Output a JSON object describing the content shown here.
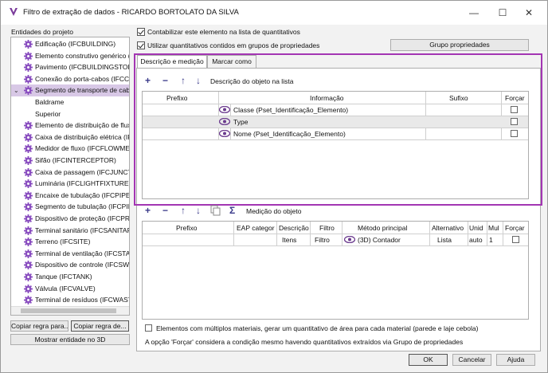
{
  "window": {
    "title": "Filtro de extração de dados - RICARDO BORTOLATO DA SILVA",
    "controls": {
      "close": "✕",
      "minimize": "—",
      "maximize": "☐"
    }
  },
  "left_panel": {
    "header": "Entidades do projeto",
    "items": [
      "Edificação (IFCBUILDING)",
      "Elemento construtivo genérico (I",
      "Pavimento (IFCBUILDINGSTOREY",
      "Conexão do porta-cabos (IFCCAI",
      "Segmento de transporte de cabo",
      "Baldrame",
      "Superior",
      "Elemento de distribuição de flux",
      "Caixa de distribuição elétrica (IFC",
      "Medidor de fluxo (IFCFLOWMETI",
      "Sifão (IFCINTERCEPTOR)",
      "Caixa de passagem (IFCJUNCTIO",
      "Luminária (IFCLIGHTFIXTURE)",
      "Encaixe de tubulação (IFCPIPEFIT",
      "Segmento de tubulação (IFCPIPE",
      "Dispositivo de proteção (IFCPRO",
      "Terminal sanitário (IFCSANITARY",
      "Terreno (IFCSITE)",
      "Terminal de ventilação (IFCSTACI",
      "Dispositivo de controle (IFCSWIT",
      "Tanque (IFCTANK)",
      "Válvula (IFCVALVE)",
      "Terminal de resíduos (IFCWASTE"
    ],
    "copy_rule_button_1": "Copiar regra para...",
    "copy_rule_button_2": "Copiar regra de...",
    "show_3d_button": "Mostrar entidade no 3D"
  },
  "options": {
    "count_element_label": "Contabilizar este elemento na lista de quantitativos",
    "use_quantities_label": "Utilizar quantitativos contidos em grupos de propriedades",
    "property_groups_button": "Grupo propriedades"
  },
  "tabs": [
    {
      "label": "Descrição e medição"
    },
    {
      "label": "Marcar como"
    }
  ],
  "description_section": {
    "toolbar_label": "Descrição do objeto na lista",
    "columns": [
      "Prefixo",
      "Informação",
      "Sufixo",
      "Forçar"
    ],
    "rows": [
      {
        "prefix": "",
        "info": "Classe (Pset_Identificação_Elemento)",
        "suffix": ""
      },
      {
        "prefix": "",
        "info": "Type",
        "suffix": ""
      },
      {
        "prefix": "",
        "info": "Nome (Pset_Identificação_Elemento)",
        "suffix": ""
      }
    ]
  },
  "measurement_section": {
    "toolbar_label": "Medição do objeto",
    "columns": [
      "Prefixo",
      "EAP categori",
      "Descrição",
      "Filtro",
      "Método principal",
      "Alternativo",
      "Unid",
      "Mul",
      "Forçar"
    ],
    "rows": [
      {
        "prefix": "",
        "eap": "",
        "description": "Itens",
        "filter": "Filtro",
        "method": "(3D) Contador",
        "alternative": "Lista",
        "unit": "auto",
        "mult": "1"
      }
    ]
  },
  "footer": {
    "multi_material_label": "Elementos com múltiplos materiais, gerar um quantitativo de área para cada material (parede e laje cebola)",
    "force_note": "A opção 'Forçar' considera a condição mesmo havendo quantitativos extraídos via Grupo de propriedades",
    "ok_button": "OK",
    "cancel_button": "Cancelar",
    "help_button": "Ajuda"
  },
  "colors": {
    "highlight_border": "#a335b3",
    "selected_row": "#d8c8e6",
    "gear": "#8a4fc0",
    "eye": "#6b3a8e"
  },
  "icons": {
    "add": "+",
    "remove": "−",
    "up": "↑",
    "down": "↓",
    "sigma": "Σ"
  }
}
